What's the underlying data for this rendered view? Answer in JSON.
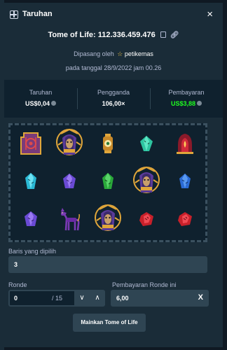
{
  "header": {
    "title": "Taruhan",
    "close_label": "×"
  },
  "bet": {
    "line": "Tome of Life: 112.336.459.476"
  },
  "placed": {
    "prefix": "Dipasang oleh",
    "user": "petikemas"
  },
  "date": "pada tanggal 28/9/2022 jam 00.26",
  "stats": [
    {
      "label": "Taruhan",
      "value": "US$0,04"
    },
    {
      "label": "Pengganda",
      "value": "106,00×"
    },
    {
      "label": "Pembayaran",
      "value": "US$3,88"
    }
  ],
  "colors": {
    "win": "#1fff20",
    "panel": "#1a2c38",
    "input": "#2f4553",
    "dark": "#0f212e"
  },
  "board": {
    "rows": [
      [
        "scarab-seal",
        "pharaoh",
        "lantern",
        "teal-gem",
        "red-flame"
      ],
      [
        "cyan-gem",
        "purple-gem",
        "green-gem",
        "pharaoh",
        "blue-gem"
      ],
      [
        "purple-gem",
        "jackal",
        "pharaoh",
        "red-gem",
        "red-gem"
      ]
    ]
  },
  "lines": {
    "label": "Baris yang dipilih",
    "value": "3"
  },
  "ronde": {
    "label": "Ronde",
    "value": "0",
    "max": "/ 15"
  },
  "payout_round": {
    "label": "Pembayaran Ronde ini",
    "value": "6,00",
    "suffix": "X"
  },
  "play_button": "Mainkan Tome of Life"
}
